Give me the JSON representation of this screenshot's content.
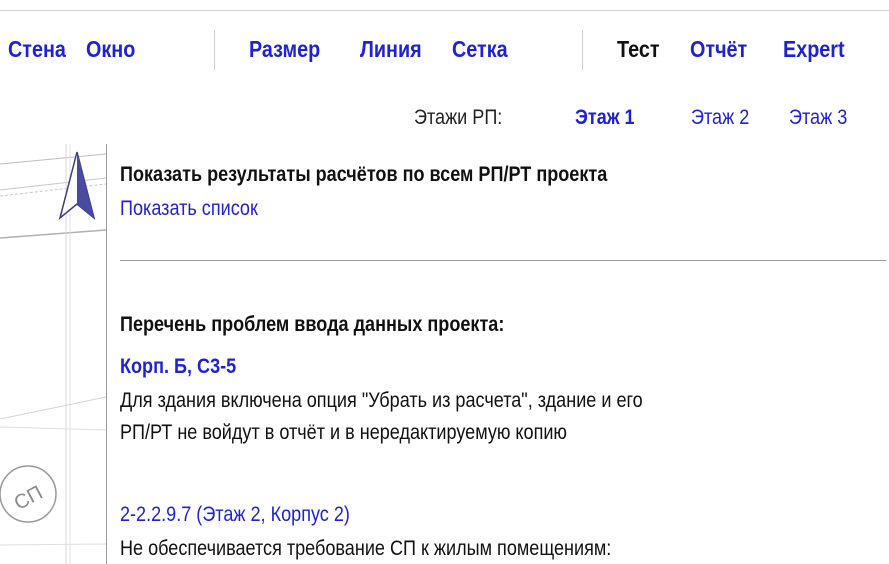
{
  "menu": {
    "items": [
      {
        "label": "Стена",
        "style": "link"
      },
      {
        "label": "Окно",
        "style": "link"
      },
      {
        "label": "Размер",
        "style": "link"
      },
      {
        "label": "Линия",
        "style": "link"
      },
      {
        "label": "Сетка",
        "style": "link"
      },
      {
        "label": "Тест",
        "style": "dark"
      },
      {
        "label": "Отчёт",
        "style": "link"
      },
      {
        "label": "Expert",
        "style": "link"
      }
    ]
  },
  "floors": {
    "label": "Этажи РП:",
    "items": [
      {
        "label": "Этаж 1",
        "active": true
      },
      {
        "label": "Этаж 2",
        "active": false
      },
      {
        "label": "Этаж 3",
        "active": false
      }
    ]
  },
  "report": {
    "heading": "Показать результаты расчётов по всем РП/РТ проекта",
    "show_list": "Показать список",
    "issues_title": "Перечень проблем ввода данных проекта:",
    "issues": [
      {
        "ref": "Корп. Б, С3-5",
        "lines": [
          "Для здания включена опция \"Убрать из расчета\", здание и его",
          "РП/РТ не войдут в отчёт и в нередактируемую копию"
        ]
      },
      {
        "ref": "2-2.2.9.7 (Этаж 2, Корпус 2)",
        "lines": [
          "Не обеспечивается требование СП к жилым помещениям:"
        ]
      }
    ]
  },
  "icons": {
    "north_arrow": "north-arrow-icon",
    "stamp": "sp-stamp-icon"
  },
  "colors": {
    "link": "#1e22d4",
    "text": "#111111",
    "separator": "#cfcfcf"
  }
}
